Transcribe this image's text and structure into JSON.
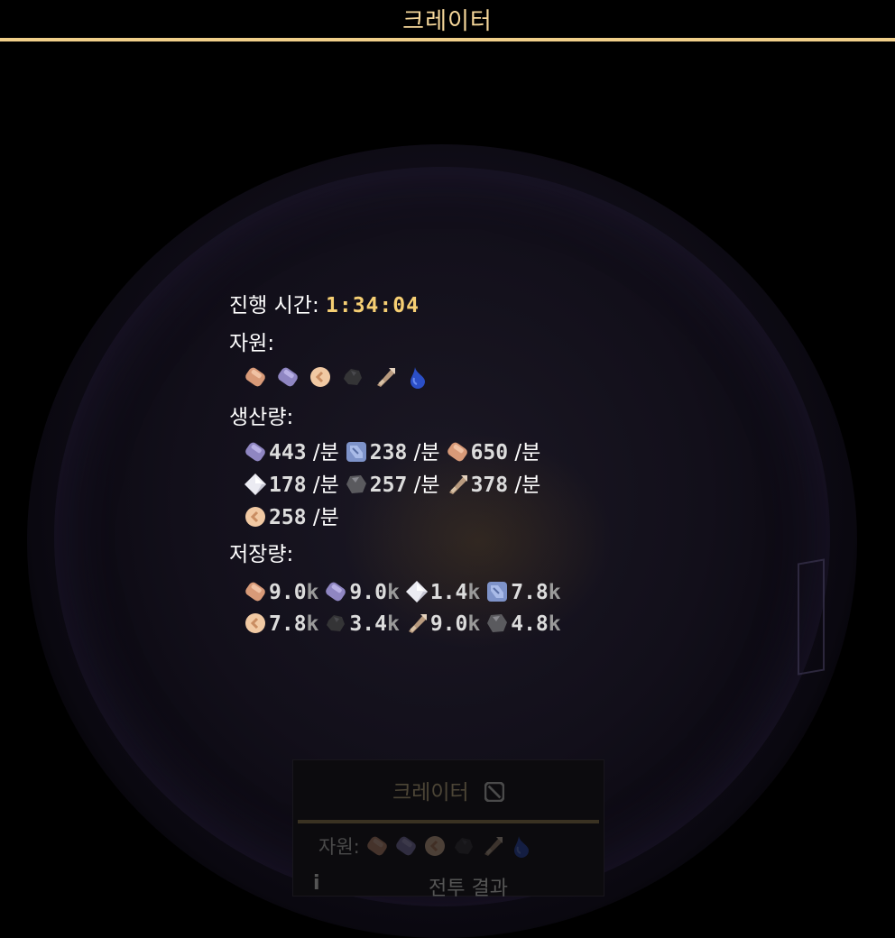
{
  "title_bar": {
    "title": "크레이터"
  },
  "summary": {
    "elapsed_label": "진행 시간:",
    "elapsed_value": "1:34:04",
    "resources_label": "자원:",
    "resources": [
      "copper-bar-icon",
      "lead-bar-icon",
      "sand-icon",
      "coal-icon",
      "scrap-icon",
      "water-drop-icon"
    ],
    "production_label": "생산량:",
    "production": [
      {
        "icon": "lead-bar-icon",
        "value": "443",
        "unit": "/분"
      },
      {
        "icon": "titanium-icon",
        "value": "238",
        "unit": "/분"
      },
      {
        "icon": "copper-bar-icon",
        "value": "650",
        "unit": "/분"
      },
      {
        "icon": "metaglass-icon",
        "value": "178",
        "unit": "/분"
      },
      {
        "icon": "graphite-icon",
        "value": "257",
        "unit": "/분"
      },
      {
        "icon": "scrap-icon",
        "value": "378",
        "unit": "/분"
      },
      {
        "icon": "sand-icon",
        "value": "258",
        "unit": "/분"
      }
    ],
    "storage_label": "저장량:",
    "storage": [
      {
        "icon": "copper-bar-icon",
        "value": "9.0",
        "suffix": "k"
      },
      {
        "icon": "lead-bar-icon",
        "value": "9.0",
        "suffix": "k"
      },
      {
        "icon": "metaglass-icon",
        "value": "1.4",
        "suffix": "k"
      },
      {
        "icon": "titanium-icon",
        "value": "7.8",
        "suffix": "k"
      },
      {
        "icon": "sand-icon",
        "value": "7.8",
        "suffix": "k"
      },
      {
        "icon": "coal-icon",
        "value": "3.4",
        "suffix": "k"
      },
      {
        "icon": "scrap-icon",
        "value": "9.0",
        "suffix": "k"
      },
      {
        "icon": "graphite-icon",
        "value": "4.8",
        "suffix": "k"
      }
    ]
  },
  "sector_panel": {
    "title": "크레이터",
    "title_icon": "blocked-icon",
    "resources_label": "자원:",
    "battle_result": "전투 결과",
    "info_icon": "info-icon"
  },
  "colors": {
    "accent": "#f0cf8a",
    "time": "#f6cf73",
    "background": "#000000"
  }
}
